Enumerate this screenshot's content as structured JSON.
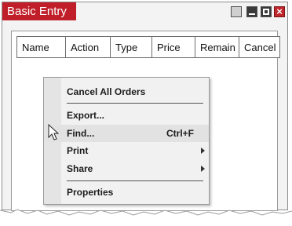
{
  "window": {
    "title": "Basic Entry",
    "controls": {
      "restore": "restore",
      "minimize": "minimize",
      "maximize": "maximize",
      "close": "×"
    }
  },
  "table": {
    "columns": [
      "Name",
      "Action",
      "Type",
      "Price",
      "Remain",
      "Cancel"
    ]
  },
  "context_menu": {
    "items": [
      {
        "label": "Cancel All Orders"
      },
      {
        "label": "Export..."
      },
      {
        "label": "Find...",
        "shortcut": "Ctrl+F",
        "state": "hover"
      },
      {
        "label": "Print",
        "submenu": true
      },
      {
        "label": "Share",
        "submenu": true
      },
      {
        "label": "Properties"
      }
    ]
  },
  "colors": {
    "title_bar": "#c01f2a",
    "close_button": "#c0262c",
    "menu_bg": "#f1f1f1"
  },
  "icons": [
    "restore-icon",
    "minimize-icon",
    "maximize-icon",
    "close-icon",
    "submenu-arrow-icon",
    "mouse-cursor-icon"
  ]
}
